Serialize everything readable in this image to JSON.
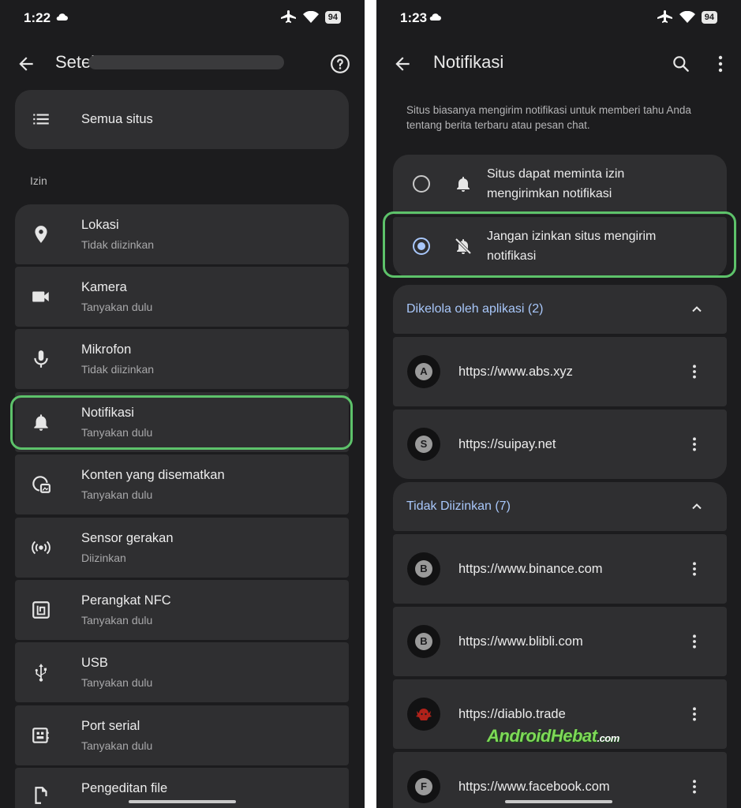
{
  "left": {
    "status": {
      "time": "1:22",
      "battery": "94"
    },
    "appbar": {
      "title": "Setel"
    },
    "all_sites": {
      "label": "Semua situs"
    },
    "section_label": "Izin",
    "items": [
      {
        "title": "Lokasi",
        "subtitle": "Tidak diizinkan",
        "icon": "location-pin-icon"
      },
      {
        "title": "Kamera",
        "subtitle": "Tanyakan dulu",
        "icon": "camera-icon"
      },
      {
        "title": "Mikrofon",
        "subtitle": "Tidak diizinkan",
        "icon": "microphone-icon"
      },
      {
        "title": "Notifikasi",
        "subtitle": "Tanyakan dulu",
        "icon": "bell-icon"
      },
      {
        "title": "Konten yang disematkan",
        "subtitle": "Tanyakan dulu",
        "icon": "embedded-content-icon"
      },
      {
        "title": "Sensor gerakan",
        "subtitle": "Diizinkan",
        "icon": "motion-sensor-icon"
      },
      {
        "title": "Perangkat NFC",
        "subtitle": "Tanyakan dulu",
        "icon": "nfc-icon"
      },
      {
        "title": "USB",
        "subtitle": "Tanyakan dulu",
        "icon": "usb-icon"
      },
      {
        "title": "Port serial",
        "subtitle": "Tanyakan dulu",
        "icon": "serial-port-icon"
      },
      {
        "title": "Pengeditan file",
        "subtitle": "",
        "icon": "file-edit-icon"
      }
    ]
  },
  "right": {
    "status": {
      "time": "1:23",
      "battery": "94"
    },
    "appbar": {
      "title": "Notifikasi"
    },
    "description": "Situs biasanya mengirim notifikasi untuk memberi tahu Anda tentang berita terbaru atau pesan chat.",
    "options": [
      {
        "label": "Situs dapat meminta izin mengirimkan notifikasi",
        "selected": false
      },
      {
        "label": "Jangan izinkan situs mengirim notifikasi",
        "selected": true
      }
    ],
    "groups": [
      {
        "title": "Dikelola oleh aplikasi (2)",
        "sites": [
          {
            "letter": "A",
            "url": "https://www.abs.xyz"
          },
          {
            "letter": "S",
            "url": "https://suipay.net"
          }
        ]
      },
      {
        "title": "Tidak Diizinkan (7)",
        "sites": [
          {
            "letter": "B",
            "url": "https://www.binance.com"
          },
          {
            "letter": "B",
            "url": "https://www.blibli.com"
          },
          {
            "letter": "",
            "url": "https://diablo.trade"
          },
          {
            "letter": "F",
            "url": "https://www.facebook.com"
          }
        ]
      }
    ],
    "watermark": {
      "main": "AndroidHebat",
      "suffix": ".com"
    }
  },
  "colors": {
    "background": "#1c1c1e",
    "card": "#2f2f31",
    "accent": "#a8c7fa",
    "highlight": "#5dc26a"
  }
}
